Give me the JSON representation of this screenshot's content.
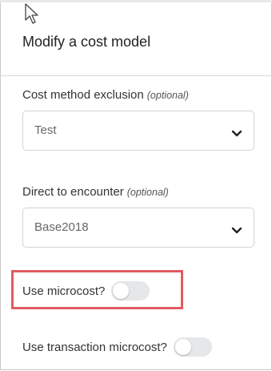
{
  "panel": {
    "title": "Modify a cost model"
  },
  "fields": {
    "cost_method_exclusion": {
      "label": "Cost method exclusion",
      "optional": "(optional)",
      "value": "Test"
    },
    "direct_to_encounter": {
      "label": "Direct to encounter",
      "optional": "(optional)",
      "value": "Base2018"
    }
  },
  "toggles": {
    "use_microcost": {
      "label": "Use microcost?",
      "on": false
    },
    "use_transaction_microcost": {
      "label": "Use transaction microcost?",
      "on": false
    }
  },
  "icons": {
    "cursor": "mouse-pointer-icon",
    "select_chevron": "chevron-down-icon"
  },
  "colors": {
    "highlight": "#e25a63",
    "switch_off": "#e6e7e9"
  }
}
